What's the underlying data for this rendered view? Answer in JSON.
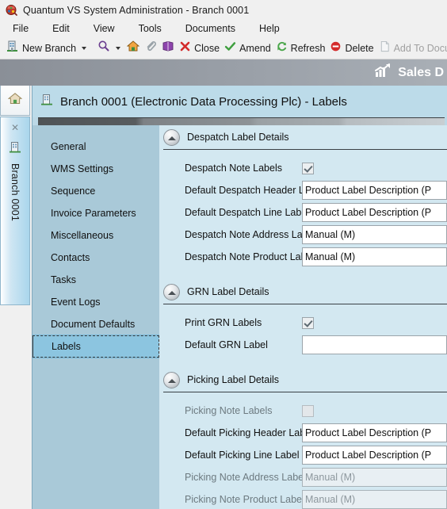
{
  "window": {
    "title": "Quantum VS System Administration -  Branch 0001",
    "app_icon": "quantum-app-icon"
  },
  "menubar": {
    "items": [
      {
        "label": "File"
      },
      {
        "label": "Edit"
      },
      {
        "label": "View"
      },
      {
        "label": "Tools"
      },
      {
        "label": "Documents"
      },
      {
        "label": "Help"
      }
    ]
  },
  "toolbar": {
    "new_branch": "New Branch",
    "close": "Close",
    "amend": "Amend",
    "refresh": "Refresh",
    "delete": "Delete",
    "add_to_documents": "Add To Docu",
    "icons": [
      "branch-icon",
      "dropdown-caret-icon",
      "search-icon",
      "search-caret-icon",
      "home-icon",
      "attachment-icon",
      "book-icon",
      "close-x-icon",
      "amend-check-icon",
      "refresh-icon",
      "delete-icon",
      "add-to-documents-icon"
    ]
  },
  "banner": {
    "label": "Sales D",
    "icon": "sales-chart-icon"
  },
  "vertical_tabs": {
    "home_icon": "home-icon",
    "close_icon": "close-x-icon",
    "branch_icon": "branch-building-icon",
    "branch_label": "Branch 0001"
  },
  "page": {
    "icon": "branch-building-icon",
    "title": "Branch 0001 (Electronic Data Processing Plc) - Labels"
  },
  "nav": {
    "items": [
      {
        "label": "General",
        "selected": false
      },
      {
        "label": "WMS Settings",
        "selected": false
      },
      {
        "label": "Sequence",
        "selected": false
      },
      {
        "label": "Invoice Parameters",
        "selected": false
      },
      {
        "label": "Miscellaneous",
        "selected": false
      },
      {
        "label": "Contacts",
        "selected": false
      },
      {
        "label": "Tasks",
        "selected": false
      },
      {
        "label": "Event Logs",
        "selected": false
      },
      {
        "label": "Document Defaults",
        "selected": false
      },
      {
        "label": "Labels",
        "selected": true
      }
    ]
  },
  "sections": {
    "despatch": {
      "title": "Despatch Label Details",
      "collapse_icon": "chevron-up-circle-icon",
      "rows": {
        "note_labels_label": "Despatch Note Labels",
        "note_labels_checked": true,
        "header_label_label": "Default Despatch Header Label",
        "header_label_value": "Product Label Description (P",
        "line_label_label": "Default Despatch Line Label",
        "line_label_value": "Product Label Description (P",
        "address_labels_label": "Despatch Note Address Labels",
        "address_labels_value": "Manual (M)",
        "product_labels_label": "Despatch Note Product Labels",
        "product_labels_value": "Manual (M)"
      }
    },
    "grn": {
      "title": "GRN Label Details",
      "collapse_icon": "chevron-up-circle-icon",
      "rows": {
        "print_labels_label": "Print GRN Labels",
        "print_labels_checked": true,
        "default_label_label": "Default GRN Label",
        "default_label_value": ""
      }
    },
    "picking": {
      "title": "Picking Label Details",
      "collapse_icon": "chevron-up-circle-icon",
      "rows": {
        "note_labels_label": "Picking Note Labels",
        "note_labels_checked": false,
        "header_label_label": "Default Picking Header Label",
        "header_label_value": "Product Label Description (P",
        "line_label_label": "Default Picking Line Label",
        "line_label_value": "Product Label Description (P",
        "address_labels_label": "Picking Note Address Labels",
        "address_labels_value": "Manual (M)",
        "product_labels_label": "Picking Note Product Labels",
        "product_labels_value": "Manual (M)"
      }
    }
  },
  "colors": {
    "chrome": "#f0f0f0",
    "card_bg": "#bcd8e6",
    "nav_bg": "#a9c9d8",
    "form_bg": "#d3e8f1",
    "nav_selected": "#8cc5e0",
    "banner_start": "#8a8f97",
    "banner_end": "#a9afb6",
    "accent_red": "#d42b2b",
    "accent_green": "#3f9f3f"
  }
}
